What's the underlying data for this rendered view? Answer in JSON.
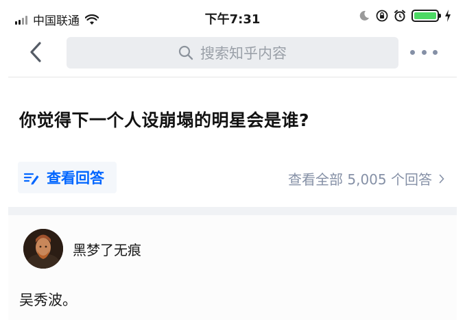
{
  "status_bar": {
    "carrier": "中国联通",
    "time": "下午7:31",
    "battery_level": 1.0,
    "icons": [
      "signal-icon",
      "wifi-icon",
      "moon-icon",
      "rotation-lock-icon",
      "alarm-icon",
      "battery-icon",
      "charging-icon"
    ]
  },
  "nav": {
    "search_placeholder": "搜索知乎内容",
    "icons": [
      "back-arrow-icon",
      "search-icon",
      "more-icon"
    ]
  },
  "question": {
    "title": "你觉得下一个人设崩塌的明星会是谁?",
    "view_answer_label": "查看回答",
    "all_answers_label": "查看全部 5,005 个回答"
  },
  "answer": {
    "author": "黑梦了无痕",
    "text": "吴秀波。"
  },
  "colors": {
    "accent": "#0066ff",
    "muted": "#8590a6",
    "search_bg": "#ebedf0",
    "battery": "#4cd964"
  }
}
